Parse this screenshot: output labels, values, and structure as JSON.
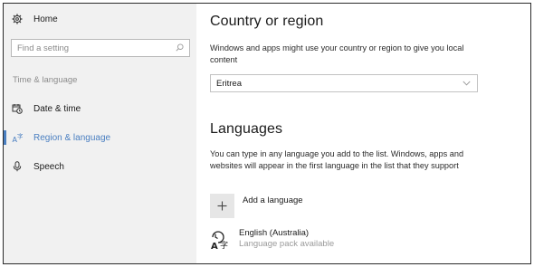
{
  "sidebar": {
    "home_label": "Home",
    "search_placeholder": "Find a setting",
    "section_title": "Time & language",
    "items": [
      {
        "label": "Date & time",
        "icon": "calendar-clock-icon"
      },
      {
        "label": "Region & language",
        "icon": "region-language-icon",
        "selected": true
      },
      {
        "label": "Speech",
        "icon": "microphone-icon"
      }
    ]
  },
  "region": {
    "title": "Country or region",
    "description": "Windows and apps might use your country or region to give you local content",
    "selected_country": "Eritrea"
  },
  "languages": {
    "title": "Languages",
    "description": "You can type in any language you add to the list. Windows, apps and websites will appear in the first language in the list that they support",
    "add_label": "Add a language",
    "items": [
      {
        "name": "English (Australia)",
        "status": "Language pack available"
      }
    ]
  },
  "colors": {
    "accent": "#4a7fc1",
    "sidebar_bg": "#f1f1f1",
    "muted_text": "#8c8c8c"
  }
}
